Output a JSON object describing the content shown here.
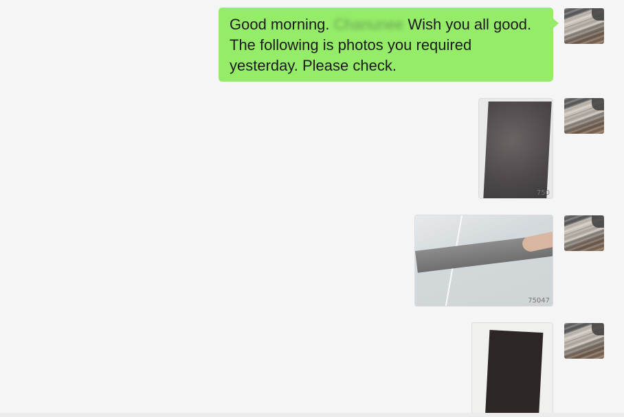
{
  "messages": [
    {
      "type": "text",
      "greeting": "Good morning.",
      "redacted_name": "Chanunee",
      "text": "Wish you all good. The following is photos you required yesterday. Please check."
    },
    {
      "type": "image",
      "caption_code": "750"
    },
    {
      "type": "image",
      "caption_code": "75047"
    },
    {
      "type": "image",
      "caption_code": ""
    }
  ],
  "colors": {
    "background": "#f5f5f5",
    "own_bubble": "#95ec69"
  }
}
